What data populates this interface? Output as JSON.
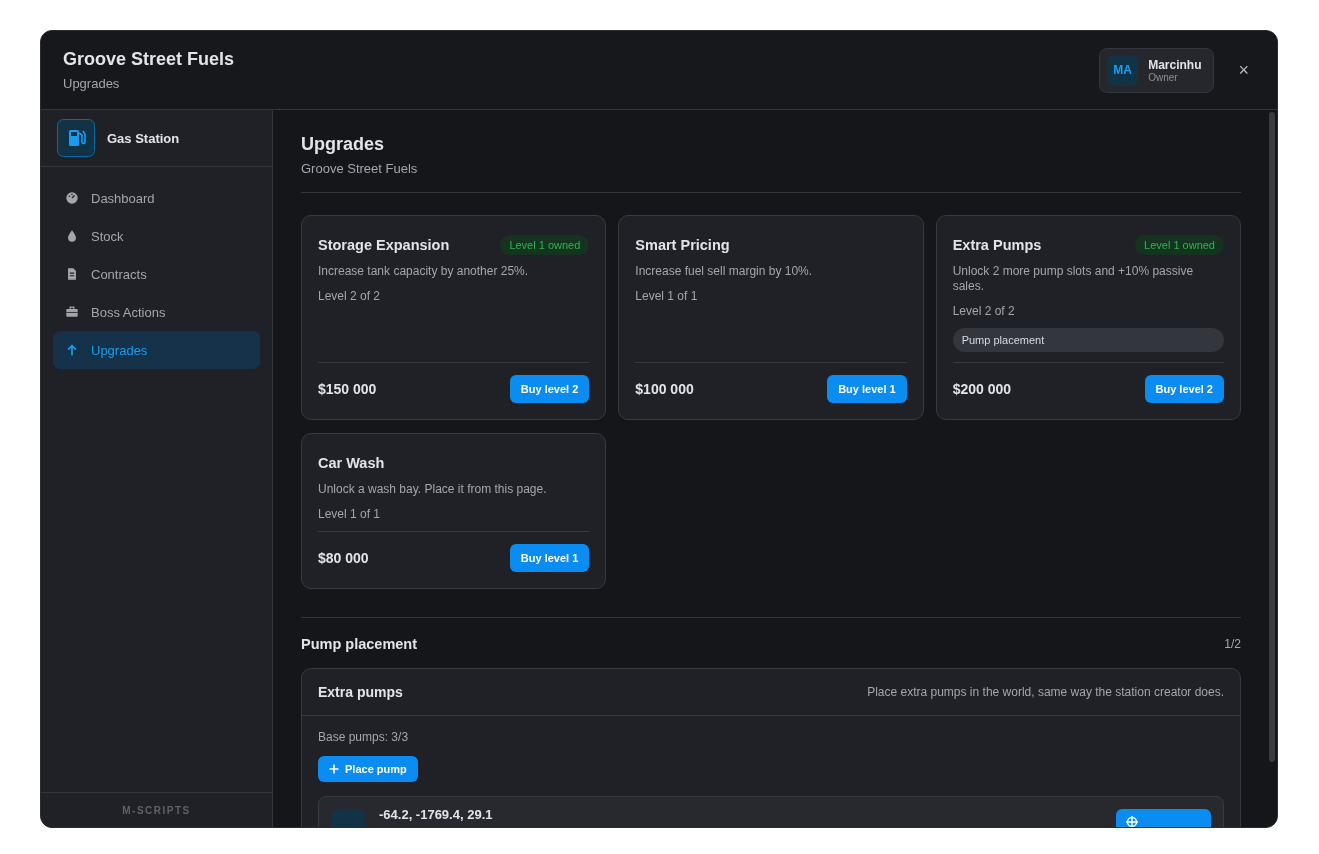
{
  "header": {
    "title": "Groove Street Fuels",
    "subtitle": "Upgrades",
    "user": {
      "initials": "MA",
      "name": "Marcinhu",
      "role": "Owner"
    },
    "close": "×"
  },
  "sidebar": {
    "brand": "Gas Station",
    "items": [
      {
        "label": "Dashboard",
        "selected": false
      },
      {
        "label": "Stock",
        "selected": false
      },
      {
        "label": "Contracts",
        "selected": false
      },
      {
        "label": "Boss Actions",
        "selected": false
      },
      {
        "label": "Upgrades",
        "selected": true
      }
    ],
    "footer": "M-SCRIPTS"
  },
  "page": {
    "title": "Upgrades",
    "subtitle": "Groove Street Fuels"
  },
  "upgrades": [
    {
      "title": "Storage Expansion",
      "badge": "Level 1 owned",
      "description": "Increase tank capacity by another 25%.",
      "level": "Level 2 of 2",
      "price": "$150 000",
      "button": "Buy level 2"
    },
    {
      "title": "Smart Pricing",
      "description": "Increase fuel sell margin by 10%.",
      "level": "Level 1 of 1",
      "price": "$100 000",
      "button": "Buy level 1"
    },
    {
      "title": "Extra Pumps",
      "badge": "Level 1 owned",
      "description": "Unlock 2 more pump slots and +10% passive sales.",
      "level": "Level 2 of 2",
      "tag": "Pump placement",
      "price": "$200 000",
      "button": "Buy level 2"
    },
    {
      "title": "Car Wash",
      "description": "Unlock a wash bay. Place it from this page.",
      "level": "Level 1 of 1",
      "price": "$80 000",
      "button": "Buy level 1"
    }
  ],
  "placement": {
    "title": "Pump placement",
    "count": "1/2",
    "panel_title": "Extra pumps",
    "panel_hint": "Place extra pumps in the world, same way the station creator does.",
    "base": "Base pumps: 3/3",
    "button": "Place pump",
    "pumps": [
      {
        "coords": "-64.2, -1769.4, 29.1"
      }
    ]
  }
}
